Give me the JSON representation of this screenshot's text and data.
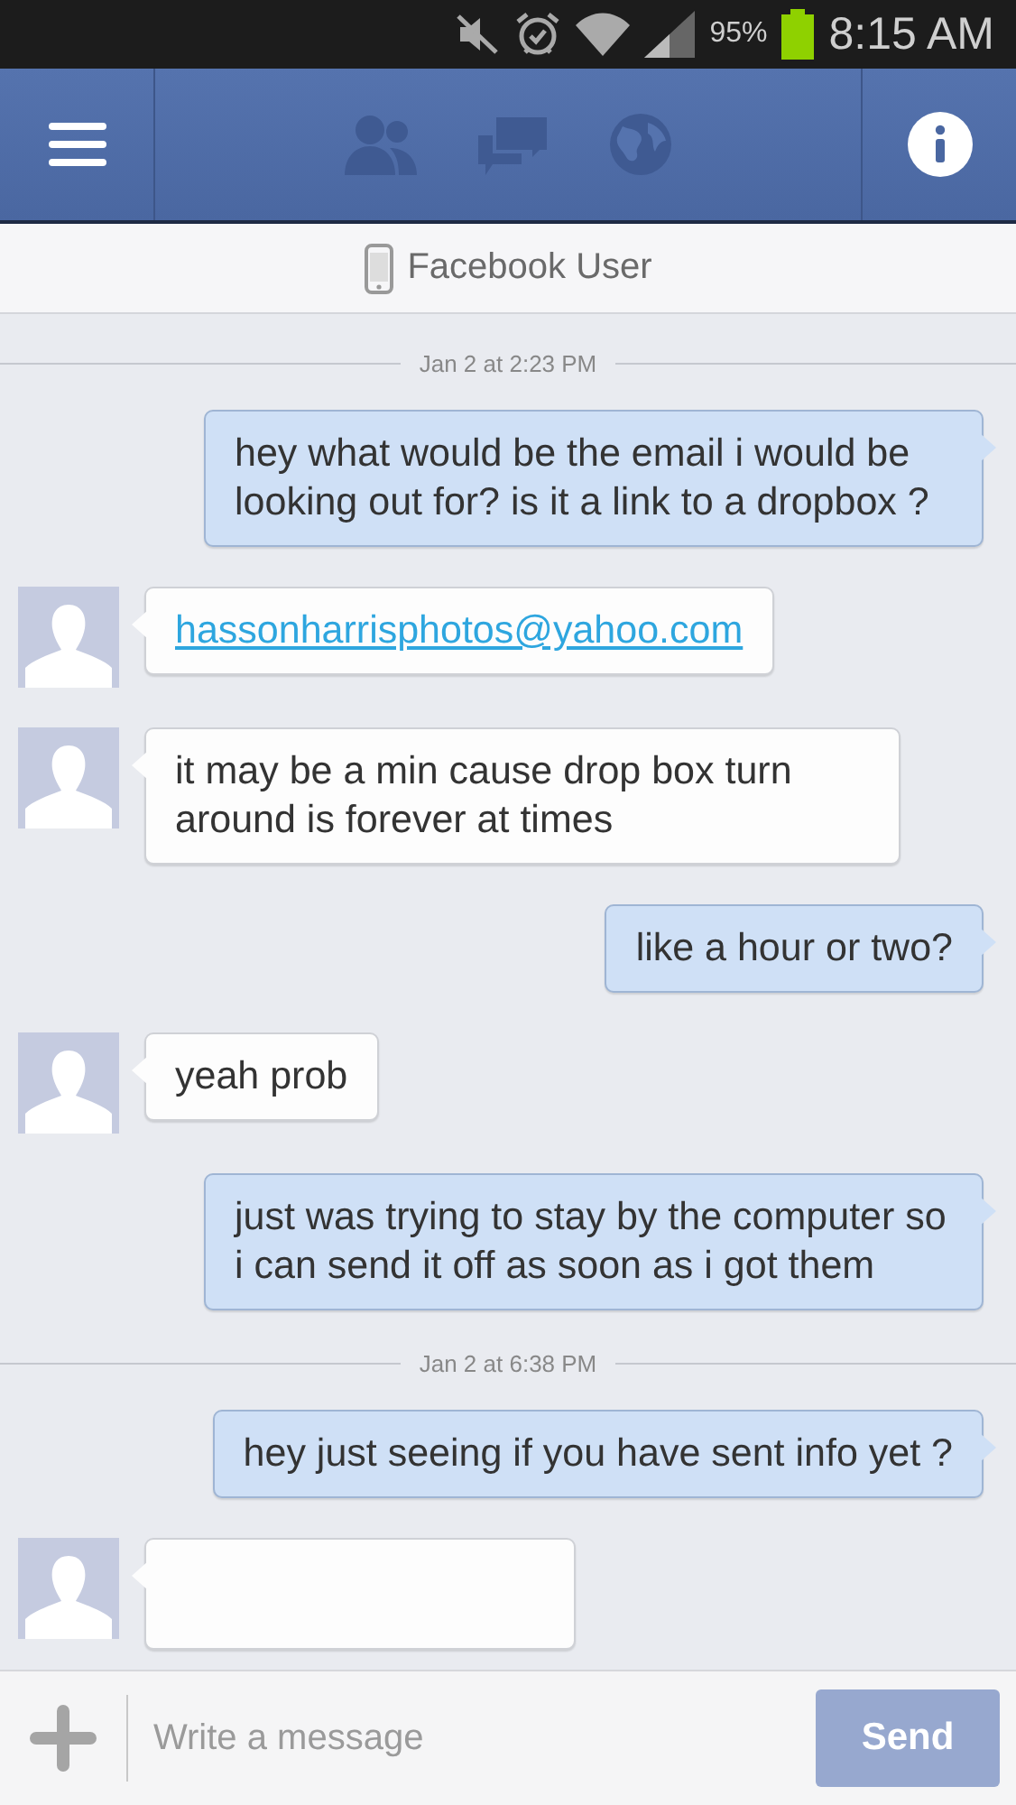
{
  "status_bar": {
    "battery": "95%",
    "time": "8:15 AM"
  },
  "conversation": {
    "title": "Facebook User"
  },
  "messages": [
    {
      "kind": "date",
      "text": "Jan 2 at 2:23 PM"
    },
    {
      "kind": "sent",
      "text": "hey what would be the email i would be looking out for? is it a link to a dropbox ?"
    },
    {
      "kind": "received",
      "text": "hassonharrisphotos@yahoo.com",
      "link": true
    },
    {
      "kind": "received",
      "text": "it may be a min cause drop box turn around is forever at times",
      "link": false
    },
    {
      "kind": "sent",
      "text": "like a hour or two?"
    },
    {
      "kind": "received",
      "text": "yeah prob",
      "link": false
    },
    {
      "kind": "sent",
      "text": "just was trying to stay by the computer so i can send it off as soon as i got them"
    },
    {
      "kind": "date",
      "text": "Jan 2 at 6:38 PM"
    },
    {
      "kind": "sent",
      "text": "hey just seeing if you have sent info yet ?"
    },
    {
      "kind": "received"
    }
  ],
  "composer": {
    "placeholder": "Write a message",
    "send_label": "Send",
    "send_disabled": true
  }
}
